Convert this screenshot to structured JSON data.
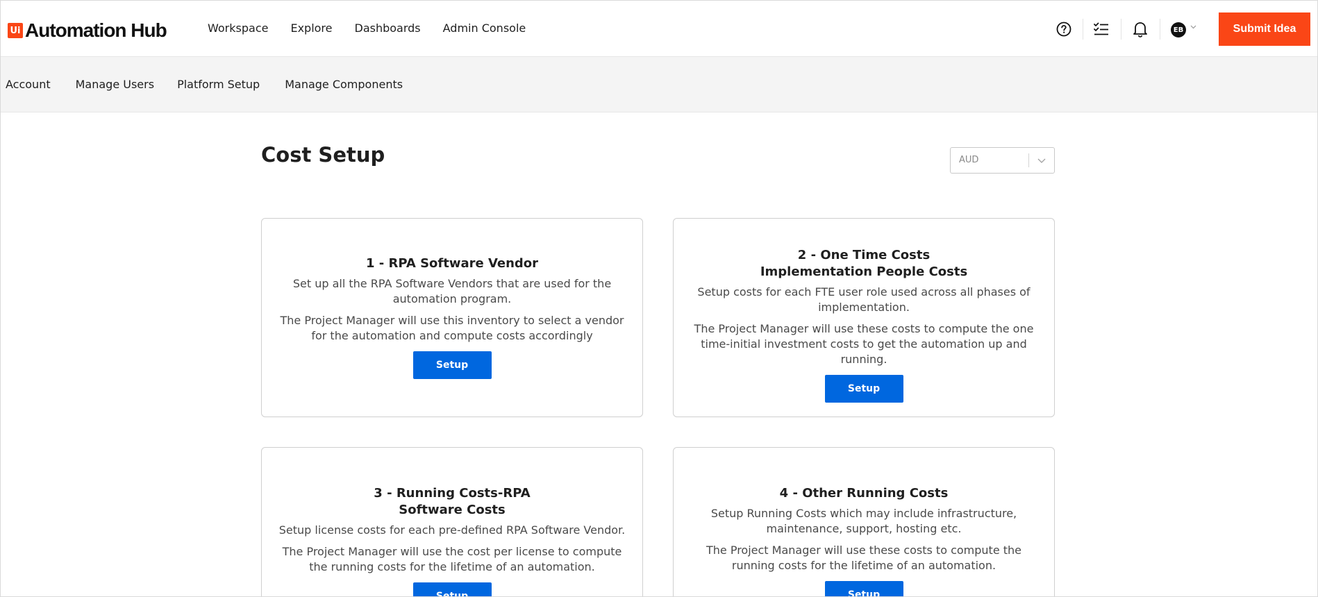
{
  "header": {
    "logo_badge": "Ui",
    "logo_text": "Automation Hub",
    "nav": [
      "Workspace",
      "Explore",
      "Dashboards",
      "Admin Console"
    ],
    "icons": [
      "help-icon",
      "tasks-checklist-icon",
      "bell-icon"
    ],
    "avatar_initials": "EB",
    "submit_label": "Submit Idea"
  },
  "subnav": {
    "items": [
      "Account",
      "Manage Users",
      "Platform Setup",
      "Manage Components"
    ]
  },
  "main": {
    "title": "Cost Setup",
    "currency": "AUD",
    "cards": [
      {
        "title_line1": "1 - RPA Software Vendor",
        "title_line2": "",
        "p1": "Set up all the RPA Software Vendors that are used for the automation program.",
        "p2": "The Project Manager will use this inventory to select a vendor for the automation and compute costs accordingly",
        "button": "Setup"
      },
      {
        "title_line1": "2 - One Time Costs",
        "title_line2": "Implementation People Costs",
        "p1": "Setup costs for each FTE user role used across all phases of implementation.",
        "p2": "The Project Manager will use these costs to compute the one time-initial investment costs to get the automation up and running.",
        "button": "Setup"
      },
      {
        "title_line1": "3 - Running Costs-RPA",
        "title_line2": "Software Costs",
        "p1": "Setup license costs for each pre-defined RPA Software Vendor.",
        "p2": "The Project Manager will use the cost per license to compute the running costs for the lifetime of an automation.",
        "button": "Setup"
      },
      {
        "title_line1": "4 - Other Running Costs",
        "title_line2": "",
        "p1": "Setup Running Costs which may include infrastructure, maintenance, support, hosting etc.",
        "p2": "The Project Manager will use these costs to compute the running costs for the lifetime of an automation.",
        "button": "Setup"
      }
    ]
  },
  "colors": {
    "brand_orange": "#fa4616",
    "primary_blue": "#0067df",
    "subnav_bg": "#f4f4f4"
  }
}
